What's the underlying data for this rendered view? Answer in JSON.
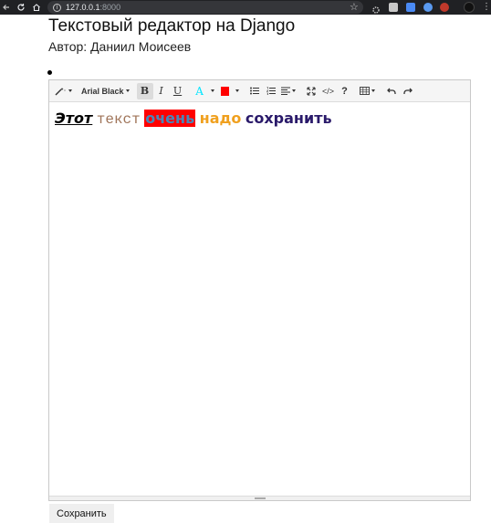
{
  "browser": {
    "url_host": "127.0.0.1",
    "url_port": ":8000",
    "nav_icons": [
      "back-arrow-icon",
      "reload-icon",
      "home-icon"
    ]
  },
  "page": {
    "title": "Текстовый редактор на Django",
    "author": "Автор: Даниил Моисеев"
  },
  "toolbar": {
    "font_name": "Arial Black",
    "bold_glyph": "B",
    "italic_glyph": "I",
    "underline_glyph": "U",
    "text_color_glyph": "A",
    "codeview_glyph": "</>",
    "help_glyph": "?",
    "colors": {
      "text_color": "#00e5ff",
      "highlight": "#ff0000"
    }
  },
  "content": {
    "words": [
      "Этот",
      "текст",
      "очень",
      "надо",
      "сохранить"
    ]
  },
  "save_button": {
    "label": "Сохранить"
  }
}
